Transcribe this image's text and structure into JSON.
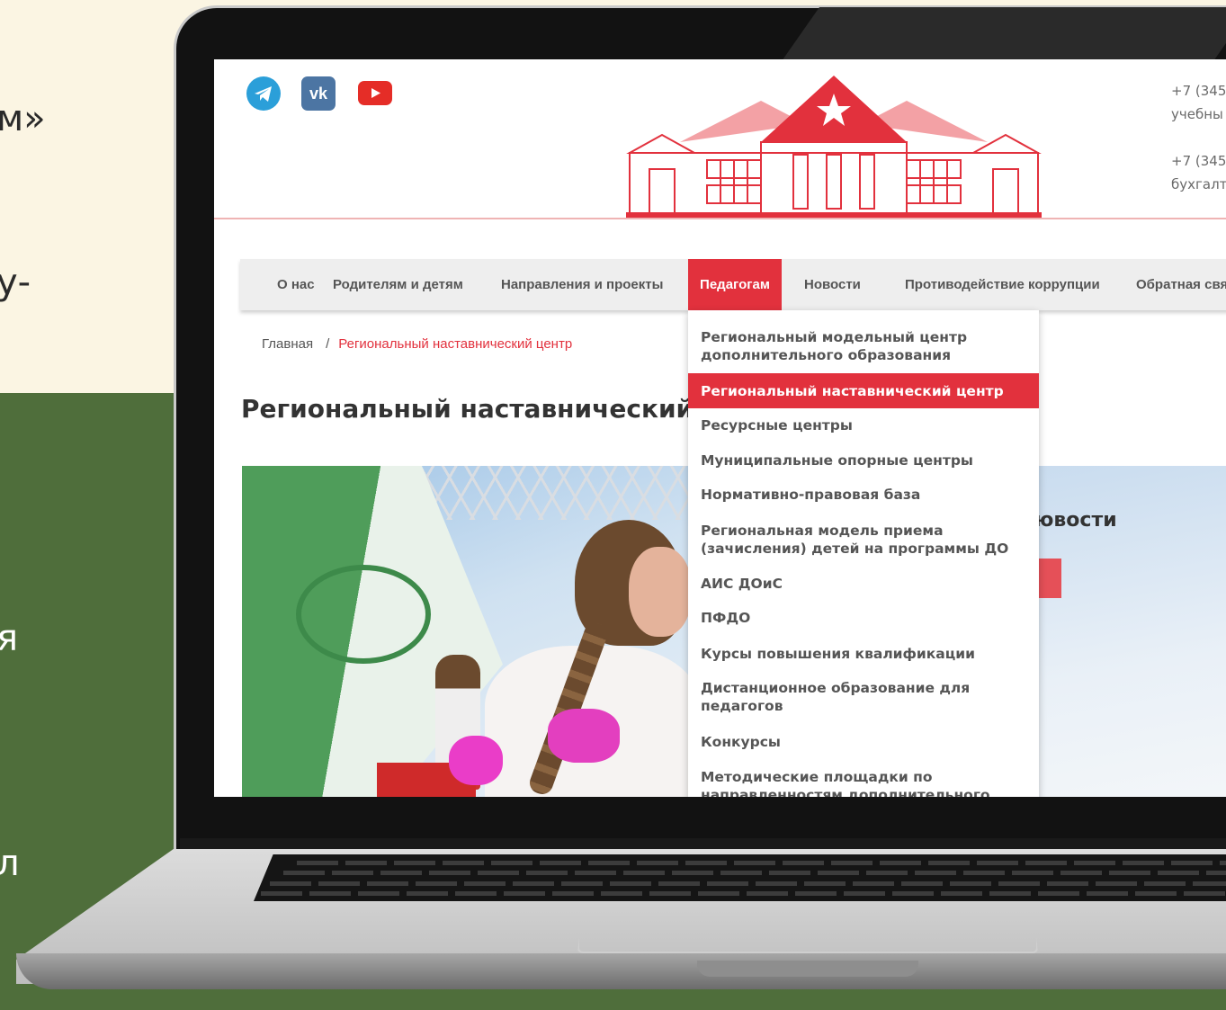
{
  "slide": {
    "left_text_1": "м»",
    "left_text_2": "у-",
    "left_text_3": "я",
    "left_text_4": "л"
  },
  "site": {
    "social": [
      {
        "name": "telegram-icon"
      },
      {
        "name": "vk-icon",
        "glyph": "vk"
      },
      {
        "name": "youtube-icon"
      }
    ],
    "phones": [
      "+7 (345",
      "учебны",
      "+7 (345",
      "бухгалт"
    ],
    "nav": {
      "items": [
        "О нас",
        "Родителям и детям",
        "Направления и проекты",
        "Педагогам",
        "Новости",
        "Противодействие коррупции",
        "Обратная свя"
      ],
      "active_index": 3
    },
    "breadcrumb": {
      "home": "Главная",
      "separator": "/",
      "current": "Региональный наставнический центр"
    },
    "page_title": "Региональный наставнический ц",
    "news_title": "ювости",
    "dropdown": {
      "items": [
        "Региональный модельный центр дополнительного образования",
        "Региональный наставнический центр",
        "Ресурсные центры",
        "Муниципальные опорные центры",
        "Нормативно-правовая база",
        "Региональная модель приема (зачисления) детей на программы ДО",
        "АИС ДОиС",
        "ПФДО",
        "Курсы повышения квалификации",
        "Дистанционное образование для педагогов",
        "Конкурсы",
        "Методические площадки по направленностям дополнительного"
      ],
      "active_index": 1
    },
    "colors": {
      "accent": "#e2313d",
      "slide_cream": "#fbf5e3",
      "slide_green": "#4f6e3b"
    }
  }
}
